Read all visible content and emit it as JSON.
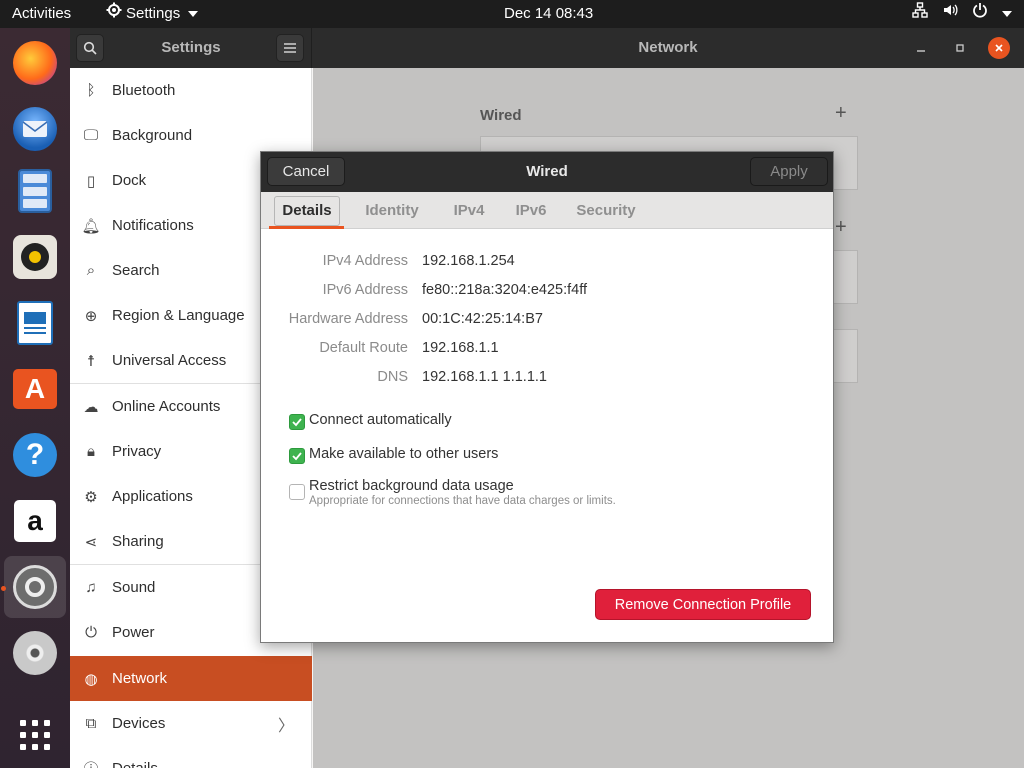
{
  "topbar": {
    "activities": "Activities",
    "app_name": "Settings",
    "clock": "Dec 14  08:43"
  },
  "settings": {
    "sidebar_title": "Settings",
    "content_title": "Network",
    "sidebar_items": [
      {
        "label": "Bluetooth",
        "icon": "bluetooth-icon"
      },
      {
        "label": "Background",
        "icon": "monitor-icon"
      },
      {
        "label": "Dock",
        "icon": "dock-icon"
      },
      {
        "label": "Notifications",
        "icon": "bell-icon"
      },
      {
        "label": "Search",
        "icon": "search-icon"
      },
      {
        "label": "Region & Language",
        "icon": "globe-icon"
      },
      {
        "label": "Universal Access",
        "icon": "accessibility-icon"
      },
      {
        "label": "Online Accounts",
        "icon": "cloud-icon"
      },
      {
        "label": "Privacy",
        "icon": "lock-icon"
      },
      {
        "label": "Applications",
        "icon": "applications-icon"
      },
      {
        "label": "Sharing",
        "icon": "share-icon"
      },
      {
        "label": "Sound",
        "icon": "music-note-icon"
      },
      {
        "label": "Power",
        "icon": "power-icon"
      },
      {
        "label": "Network",
        "icon": "network-globe-icon",
        "selected": true
      },
      {
        "label": "Devices",
        "icon": "devices-icon"
      },
      {
        "label": "Details",
        "icon": "info-icon"
      }
    ],
    "network_section_label": "Wired"
  },
  "dialog": {
    "title": "Wired",
    "cancel_label": "Cancel",
    "apply_label": "Apply",
    "tabs": [
      "Details",
      "Identity",
      "IPv4",
      "IPv6",
      "Security"
    ],
    "active_tab": "Details",
    "details": [
      {
        "label": "IPv4 Address",
        "value": "192.168.1.254"
      },
      {
        "label": "IPv6 Address",
        "value": "fe80::218a:3204:e425:f4ff"
      },
      {
        "label": "Hardware Address",
        "value": "00:1C:42:25:14:B7"
      },
      {
        "label": "Default Route",
        "value": "192.168.1.1"
      },
      {
        "label": "DNS",
        "value": "192.168.1.1 1.1.1.1"
      }
    ],
    "options": [
      {
        "label": "Connect automatically",
        "checked": true,
        "sub": ""
      },
      {
        "label": "Make available to other users",
        "checked": true,
        "sub": ""
      },
      {
        "label": "Restrict background data usage",
        "checked": false,
        "sub": "Appropriate for connections that have data charges or limits."
      }
    ],
    "remove_label": "Remove Connection Profile"
  },
  "colors": {
    "accent": "#e95420",
    "selected_row": "#c84e22",
    "destructive": "#e0203b",
    "check_on": "#3eb34f"
  }
}
